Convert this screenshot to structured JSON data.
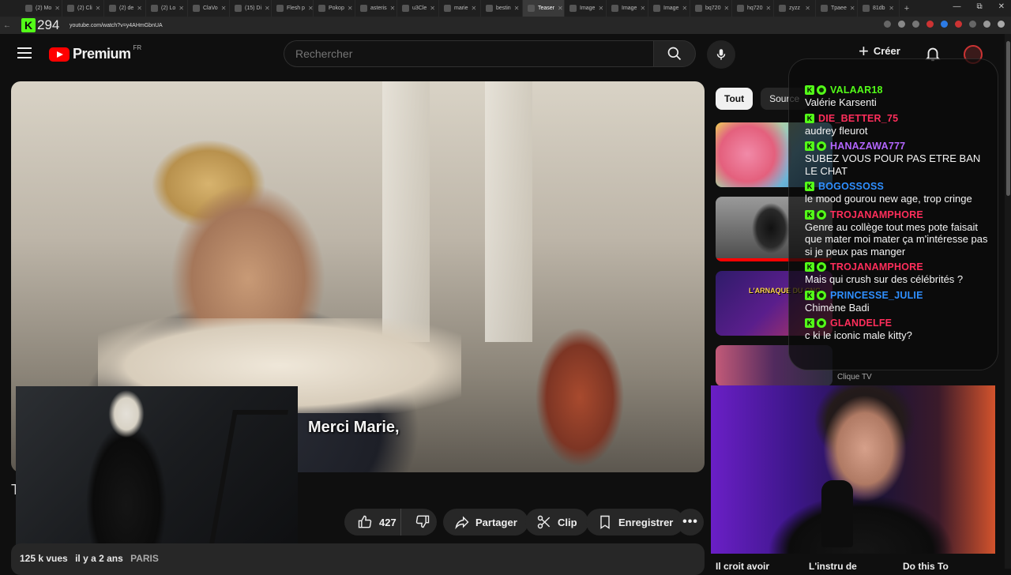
{
  "browser": {
    "tabs": [
      {
        "label": "(2) Mo"
      },
      {
        "label": "(2) Cli"
      },
      {
        "label": "(2) de"
      },
      {
        "label": "(2) Lo"
      },
      {
        "label": "ClaVo"
      },
      {
        "label": "(15) Di"
      },
      {
        "label": "Flesh p"
      },
      {
        "label": "Pokop"
      },
      {
        "label": "asteris"
      },
      {
        "label": "u3Cle"
      },
      {
        "label": "marie"
      },
      {
        "label": "bestin"
      },
      {
        "label": "Teaser",
        "active": true
      },
      {
        "label": "Image"
      },
      {
        "label": "Image"
      },
      {
        "label": "Image"
      },
      {
        "label": "bq720"
      },
      {
        "label": "hq720"
      },
      {
        "label": "zyzz"
      },
      {
        "label": "Tpaee"
      },
      {
        "label": "81db"
      }
    ],
    "url": "youtube.com/watch?v=y4AHmGbnUA",
    "window_controls": {
      "minimize": "—",
      "maximize": "⧉",
      "close": "✕"
    }
  },
  "kick_overlay": {
    "viewer_count": "294"
  },
  "header": {
    "logo_text": "Premium",
    "region": "FR",
    "search_placeholder": "Rechercher",
    "create_label": "Créer"
  },
  "video": {
    "subtitle": "Merci Marie,",
    "partial_title": "T"
  },
  "actions": {
    "like_count": "427",
    "share_label": "Partager",
    "clip_label": "Clip",
    "save_label": "Enregistrer"
  },
  "description": {
    "views": "125 k vues",
    "date": "il y a 2 ans",
    "tag": "PARIS"
  },
  "sidebar": {
    "chips": [
      {
        "label": "Tout",
        "active": true
      },
      {
        "label": "Source"
      }
    ],
    "channel_meta": "Clique TV",
    "bottom_titles": [
      "Il croit avoir",
      "L'instru de",
      "Do this To"
    ],
    "thumb3_label": "L'ARNAQUE DU CNC"
  },
  "chat": {
    "messages": [
      {
        "user": "VALAAR18",
        "color": "#53fc18",
        "text": "Valérie Karsenti",
        "sub": true
      },
      {
        "user": "DIE_BETTER_75",
        "color": "#ff2e5b",
        "text": "audrey fleurot",
        "sub": false
      },
      {
        "user": "HANAZAWA777",
        "color": "#b366ff",
        "text": "SUBEZ VOUS POUR PAS ETRE BAN LE CHAT",
        "sub": true
      },
      {
        "user": "BOGOSSOSS",
        "color": "#2f8fff",
        "text": "le mood gourou new age, trop cringe",
        "sub": false
      },
      {
        "user": "TROJANAMPHORE",
        "color": "#ff2e5b",
        "text": "Genre au collège tout mes pote faisait que mater moi mater ça m'intéresse pas si je peux pas manger",
        "sub": true
      },
      {
        "user": "TROJANAMPHORE",
        "color": "#ff2e5b",
        "text": "Mais qui crush sur des célébrités ?",
        "sub": true
      },
      {
        "user": "PRINCESSE_JULIE",
        "color": "#2f8fff",
        "text": "Chimène Badi",
        "sub": true
      },
      {
        "user": "GLANDELFE",
        "color": "#ff2e5b",
        "text": "c ki le iconic male kitty?",
        "sub": true
      }
    ]
  }
}
